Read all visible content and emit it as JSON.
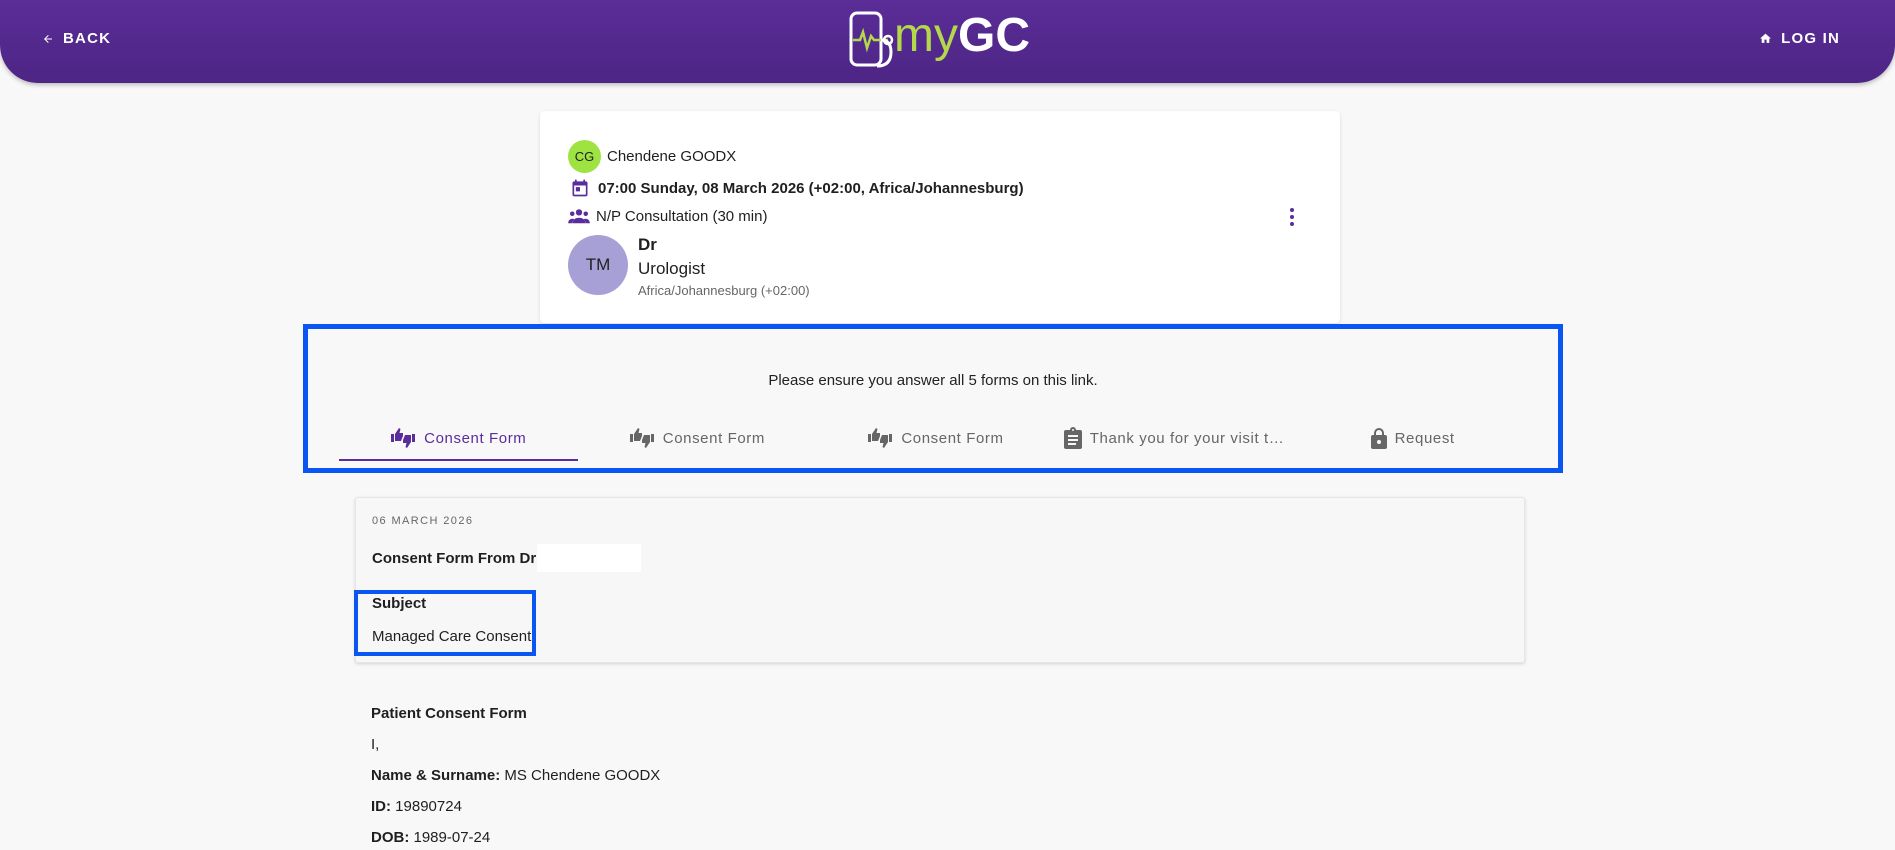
{
  "header": {
    "back_label": "BACK",
    "logo_my": "my",
    "logo_gc": "GC",
    "login_label": "LOG IN",
    "colors": {
      "bar": "#51288b",
      "logo_green": "#b4d84b"
    }
  },
  "appointment": {
    "patient_initials": "CG",
    "patient_name": "Chendene GOODX",
    "datetime": "07:00 Sunday, 08 March 2026 (+02:00, Africa/Johannesburg)",
    "consult_type": "N/P Consultation (30 min)",
    "doctor_initials": "TM",
    "doctor_title": "Dr",
    "doctor_specialty": "Urologist",
    "doctor_timezone": "Africa/Johannesburg (+02:00)"
  },
  "forms": {
    "message": "Please ensure you answer all 5 forms on this link.",
    "tabs": [
      {
        "label": "Consent Form",
        "icon": "thumbs-up-down-icon",
        "active": true
      },
      {
        "label": "Consent Form",
        "icon": "thumbs-up-down-icon",
        "active": false
      },
      {
        "label": "Consent Form",
        "icon": "thumbs-up-down-icon",
        "active": false
      },
      {
        "label": "Thank you for your visit t…",
        "icon": "clipboard-icon",
        "active": false
      },
      {
        "label": "Request",
        "icon": "lock-icon",
        "active": false
      }
    ]
  },
  "detail": {
    "date": "06 MARCH 2026",
    "from": "Consent Form From Dr",
    "subject_label": "Subject",
    "subject_value": "Managed Care Consent"
  },
  "form_body": {
    "title": "Patient Consent Form",
    "intro": "I,",
    "name_key": "Name & Surname:",
    "name_value": "MS Chendene GOODX",
    "id_key": "ID:",
    "id_value": "19890724",
    "dob_key": "DOB:",
    "dob_value": "1989-07-24"
  }
}
